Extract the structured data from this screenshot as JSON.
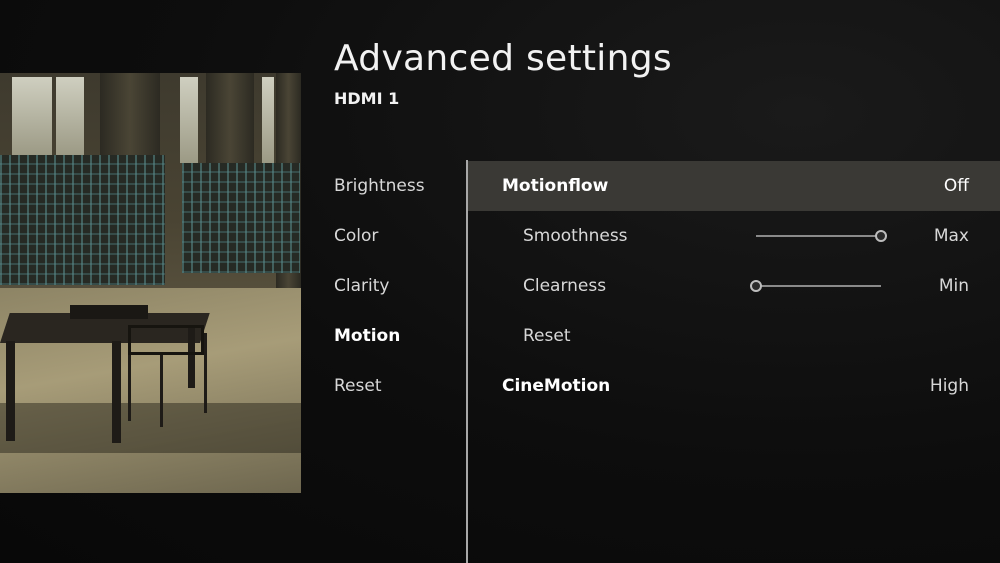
{
  "header": {
    "title": "Advanced settings",
    "subtitle": "HDMI 1"
  },
  "categories": [
    {
      "label": "Brightness",
      "active": false
    },
    {
      "label": "Color",
      "active": false
    },
    {
      "label": "Clarity",
      "active": false
    },
    {
      "label": "Motion",
      "active": true
    },
    {
      "label": "Reset",
      "active": false
    }
  ],
  "settings": {
    "motionflow": {
      "label": "Motionflow",
      "value": "Off"
    },
    "smoothness": {
      "label": "Smoothness",
      "value": "Max",
      "level": 1.0
    },
    "clearness": {
      "label": "Clearness",
      "value": "Min",
      "level": 0.0
    },
    "reset": {
      "label": "Reset"
    },
    "cinemotion": {
      "label": "CineMotion",
      "value": "High"
    }
  },
  "colors": {
    "highlight_row": "#3a3935",
    "divider": "#a8a8a8"
  }
}
